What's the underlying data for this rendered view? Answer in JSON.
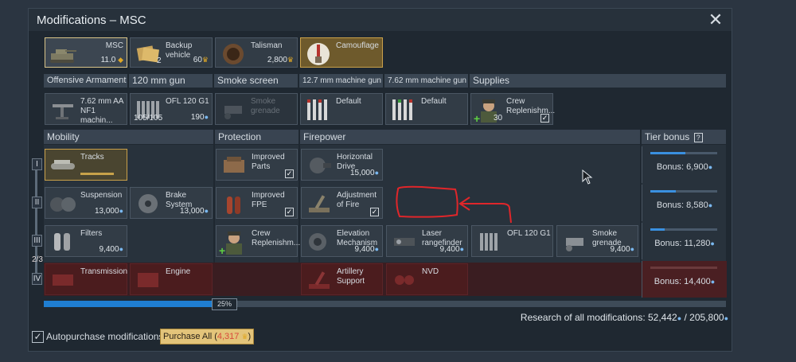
{
  "window": {
    "title": "Modifications – MSC"
  },
  "top_slots": [
    {
      "name": "MSC",
      "value": "11.0"
    },
    {
      "name": "Backup vehicle",
      "count": "2",
      "price": "60"
    },
    {
      "name": "Talisman",
      "price": "2,800"
    },
    {
      "name": "Camouflage"
    }
  ],
  "weapon_headers": [
    "Offensive Armament",
    "120 mm gun",
    "Smoke screen",
    "12.7 mm machine gun",
    "7.62 mm machine gun",
    "Supplies"
  ],
  "weapon_cards": [
    {
      "name": "7.62 mm AA NF1 machin..."
    },
    {
      "name": "OFL 120 G1",
      "ammo": "105/105",
      "price": "190"
    },
    {
      "name": "Smoke grenade"
    },
    {
      "name": "Default"
    },
    {
      "name": "Default"
    },
    {
      "name": "Crew Replenishm...",
      "count": "30"
    }
  ],
  "sections": {
    "mobility": "Mobility",
    "protection": "Protection",
    "firepower": "Firepower",
    "tier_bonus": "Tier bonus",
    "tier_help": "?"
  },
  "tiers": [
    "I",
    "II",
    "III",
    "2/3",
    "IV"
  ],
  "mods": {
    "tracks": {
      "name": "Tracks"
    },
    "suspension": {
      "name": "Suspension",
      "price": "13,000"
    },
    "brake": {
      "name": "Brake System",
      "price": "13,000"
    },
    "filters": {
      "name": "Filters",
      "price": "9,400"
    },
    "transmission": {
      "name": "Transmission"
    },
    "engine": {
      "name": "Engine"
    },
    "improved_parts": {
      "name": "Improved Parts"
    },
    "improved_fpe": {
      "name": "Improved FPE"
    },
    "crew_replenish": {
      "name": "Crew Replenishm..."
    },
    "horizontal_drive": {
      "name": "Horizontal Drive",
      "price": "15,000"
    },
    "adjustment_fire": {
      "name": "Adjustment of Fire"
    },
    "elevation": {
      "name": "Elevation Mechanism",
      "price": "9,400"
    },
    "laser": {
      "name": "Laser rangefinder",
      "price": "9,400"
    },
    "ofl": {
      "name": "OFL 120 G1"
    },
    "smoke_grenade": {
      "name": "Smoke grenade",
      "price": "9,400"
    },
    "artillery": {
      "name": "Artillery Support"
    },
    "nvd": {
      "name": "NVD"
    }
  },
  "bonuses": [
    {
      "label": "Bonus: 6,900",
      "fill": 0.52
    },
    {
      "label": "Bonus: 8,580",
      "fill": 0.38
    },
    {
      "label": "Bonus: 11,280",
      "fill": 0.22
    },
    {
      "label": "Bonus: 14,400",
      "fill": 0.0
    }
  ],
  "progress": {
    "percent": "25%",
    "fill": 0.25
  },
  "research": {
    "text": "Research of all modifications: 52,442",
    "separator": "/",
    "total": "205,800"
  },
  "autopurchase": {
    "label": "Autopurchase modifications",
    "checked": true
  },
  "purchase_all": {
    "label": "Purchase All (",
    "cost": "4,317",
    "suffix": ")"
  },
  "colors": {
    "accent": "#e3c47a",
    "research_blue": "#1f7ed1",
    "annotation_red": "#e0262a",
    "locked_red": "#4b1c1e"
  }
}
